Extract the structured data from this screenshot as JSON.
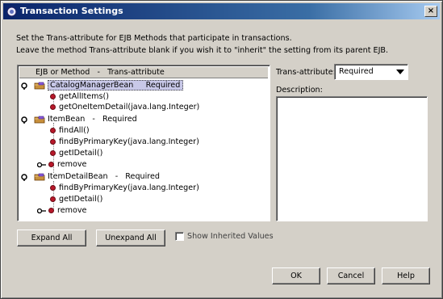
{
  "window": {
    "title": "Transaction Settings",
    "close_glyph": "×"
  },
  "intro": {
    "line1": "Set the Trans-attribute for EJB Methods that participate in transactions.",
    "line2": "Leave the method Trans-attribute blank if you wish it to \"inherit\" the setting from its parent EJB."
  },
  "tree": {
    "header": "EJB or Method   -   Trans-attribute",
    "beans": [
      {
        "label": "CatalogManagerBean     Required",
        "methods": [
          "getAllItems()",
          "getOneItemDetail(java.lang.Integer)"
        ],
        "has_remove": false
      },
      {
        "label": "ItemBean   -   Required",
        "methods": [
          "findAll()",
          "findByPrimaryKey(java.lang.Integer)",
          "getIDetail()"
        ],
        "has_remove": true
      },
      {
        "label": "ItemDetailBean   -   Required",
        "methods": [
          "findByPrimaryKey(java.lang.Integer)",
          "getIDetail()"
        ],
        "has_remove": true
      }
    ],
    "remove_label": "remove"
  },
  "trans_attribute": {
    "label": "Trans-attribute:",
    "value": "Required"
  },
  "description": {
    "label": "Description:"
  },
  "buttons": {
    "expand_all": "Expand All",
    "unexpand_all": "Unexpand All",
    "ok": "OK",
    "cancel": "Cancel",
    "help": "Help"
  },
  "show_inherited": {
    "label": "Show Inherited Values",
    "checked": false
  },
  "colors": {
    "title_bar": "#0a246a",
    "selection": "#c8c8e8",
    "method_dot": "#b8182a",
    "bean_folder": "#b07830"
  },
  "icons": {
    "key": "key-icon",
    "folder": "folder-icon",
    "method": "method-dot-icon",
    "dropdown": "dropdown-arrow-icon"
  }
}
